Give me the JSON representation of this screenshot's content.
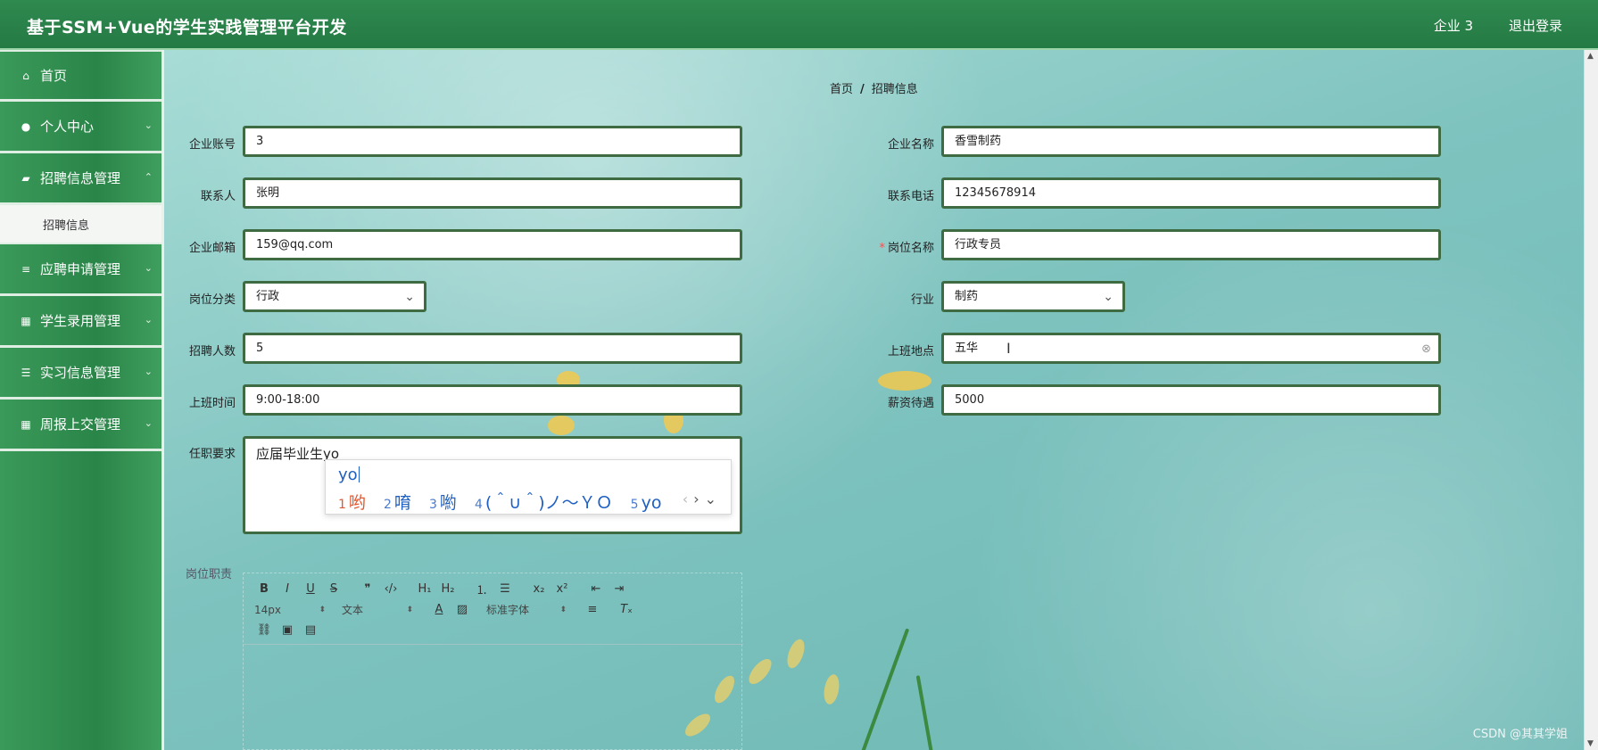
{
  "header": {
    "title": "基于SSM+Vue的学生实践管理平台开发",
    "user": "企业 3",
    "logout": "退出登录"
  },
  "sidebar": {
    "items": [
      {
        "label": "首页",
        "icon": "home-icon"
      },
      {
        "label": "个人中心",
        "icon": "user-icon"
      },
      {
        "label": "招聘信息管理",
        "icon": "chat-icon"
      },
      {
        "label": "应聘申请管理",
        "icon": "list-icon"
      },
      {
        "label": "学生录用管理",
        "icon": "grid-icon"
      },
      {
        "label": "实习信息管理",
        "icon": "sliders-icon"
      },
      {
        "label": "周报上交管理",
        "icon": "grid-icon"
      }
    ],
    "submenu": [
      "招聘信息"
    ]
  },
  "breadcrumb": {
    "home": "首页",
    "sep": "/",
    "current": "招聘信息"
  },
  "form": {
    "company_account": {
      "label": "企业账号",
      "value": "3"
    },
    "company_name": {
      "label": "企业名称",
      "value": "香雪制药"
    },
    "contact": {
      "label": "联系人",
      "value": "张明"
    },
    "phone": {
      "label": "联系电话",
      "value": "12345678914"
    },
    "email": {
      "label": "企业邮箱",
      "value": "159@qq.com"
    },
    "position": {
      "label": "岗位名称",
      "value": "行政专员",
      "required_mark": "*"
    },
    "category": {
      "label": "岗位分类",
      "value": "行政"
    },
    "industry": {
      "label": "行业",
      "value": "制药"
    },
    "headcount": {
      "label": "招聘人数",
      "value": "5"
    },
    "location": {
      "label": "上班地点",
      "value": "五华"
    },
    "work_time": {
      "label": "上班时间",
      "value": "9:00-18:00"
    },
    "salary": {
      "label": "薪资待遇",
      "value": "5000"
    },
    "requirements": {
      "label": "任职要求",
      "value": "应届毕业生yo"
    },
    "duties": {
      "label": "岗位职责"
    }
  },
  "ime": {
    "input": "yo",
    "candidates": [
      {
        "n": "1",
        "text": "哟"
      },
      {
        "n": "2",
        "text": "唷"
      },
      {
        "n": "3",
        "text": "喲"
      },
      {
        "n": "4",
        "text": "(＾∪＾)ノ～ＹＯ"
      },
      {
        "n": "5",
        "text": "yo"
      }
    ],
    "prev": "‹",
    "next": "›",
    "expand": "⌄"
  },
  "editor": {
    "font_size": "14px",
    "paragraph": "文本",
    "font_family": "标准字体"
  },
  "watermark": "CSDN @其其学姐"
}
